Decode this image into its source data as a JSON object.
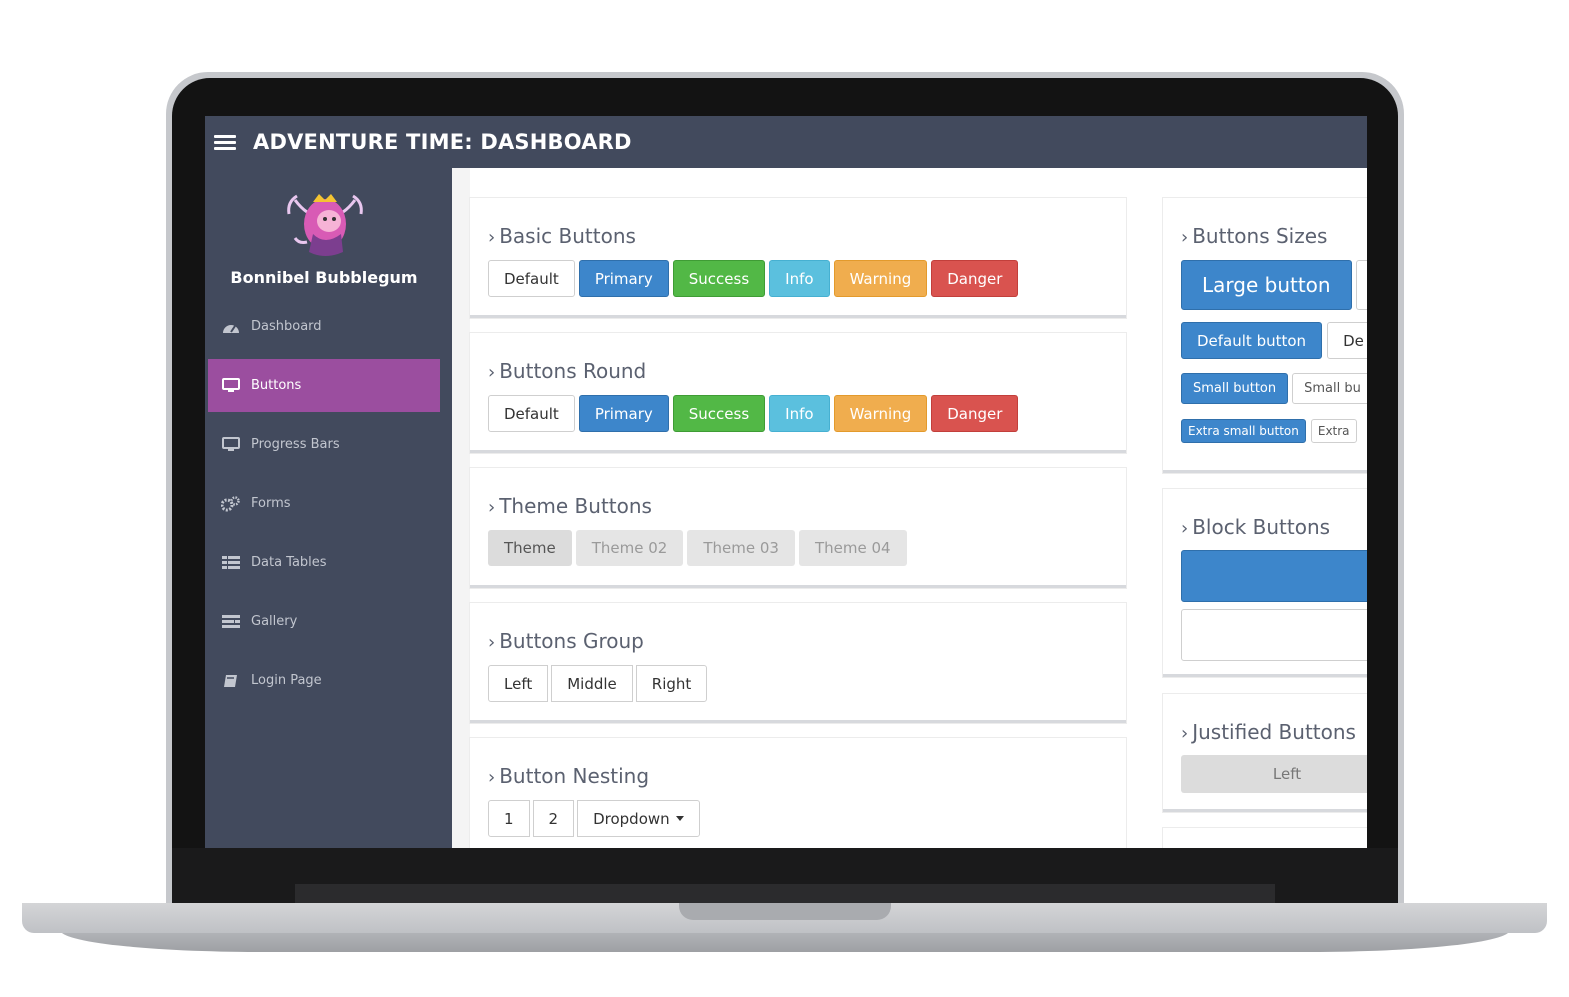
{
  "app": {
    "title": "ADVENTURE TIME: DASHBOARD"
  },
  "user": {
    "name": "Bonnibel Bubblegum"
  },
  "sidebar": {
    "items": [
      {
        "label": "Dashboard",
        "icon": "dashboard-icon"
      },
      {
        "label": "Buttons",
        "icon": "desktop-icon",
        "active": true
      },
      {
        "label": "Progress Bars",
        "icon": "desktop-icon"
      },
      {
        "label": "Forms",
        "icon": "cogs-icon"
      },
      {
        "label": "Data Tables",
        "icon": "table-icon"
      },
      {
        "label": "Gallery",
        "icon": "gallery-icon"
      },
      {
        "label": "Login Page",
        "icon": "book-icon"
      }
    ]
  },
  "panels": {
    "basic": {
      "title": "Basic Buttons",
      "buttons": [
        "Default",
        "Primary",
        "Success",
        "Info",
        "Warning",
        "Danger"
      ]
    },
    "round": {
      "title": "Buttons Round",
      "buttons": [
        "Default",
        "Primary",
        "Success",
        "Info",
        "Warning",
        "Danger"
      ]
    },
    "theme": {
      "title": "Theme Buttons",
      "buttons": [
        "Theme",
        "Theme 02",
        "Theme 03",
        "Theme 04"
      ]
    },
    "group": {
      "title": "Buttons Group",
      "buttons": [
        "Left",
        "Middle",
        "Right"
      ]
    },
    "nesting": {
      "title": "Button Nesting",
      "buttons": [
        "1",
        "2",
        "Dropdown"
      ]
    },
    "sizes": {
      "title": "Buttons Sizes",
      "large": "Large button",
      "default": "Default button",
      "default_cut": "De",
      "small": "Small button",
      "small_cut": "Small bu",
      "xsmall": "Extra small button",
      "xsmall_cut": "Extra"
    },
    "block": {
      "title": "Block Buttons"
    },
    "justified": {
      "title": "Justified Buttons",
      "buttons": [
        "Left"
      ]
    }
  },
  "colors": {
    "topbar": "#424a5d",
    "sidebar": "#424a5d",
    "active": "#9b4e9f",
    "primary": "#3d86cb",
    "success": "#52b846",
    "info": "#5bc0de",
    "warning": "#f0ad4e",
    "danger": "#d9534f"
  }
}
